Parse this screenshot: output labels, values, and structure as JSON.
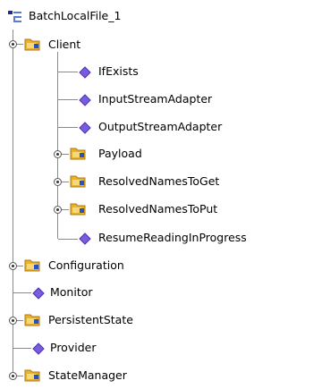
{
  "tree": {
    "root": {
      "label": "BatchLocalFile_1",
      "icon": "component-tree-icon"
    },
    "client": {
      "label": "Client",
      "icon": "folder-icon",
      "children": [
        {
          "label": "IfExists",
          "icon": "attribute-diamond-icon"
        },
        {
          "label": "InputStreamAdapter",
          "icon": "attribute-diamond-icon"
        },
        {
          "label": "OutputStreamAdapter",
          "icon": "attribute-diamond-icon"
        },
        {
          "label": "Payload",
          "icon": "folder-icon"
        },
        {
          "label": "ResolvedNamesToGet",
          "icon": "folder-icon"
        },
        {
          "label": "ResolvedNamesToPut",
          "icon": "folder-icon"
        },
        {
          "label": "ResumeReadingInProgress",
          "icon": "attribute-diamond-icon"
        }
      ]
    },
    "nodes": [
      {
        "label": "Configuration",
        "icon": "folder-icon"
      },
      {
        "label": "Monitor",
        "icon": "attribute-diamond-icon"
      },
      {
        "label": "PersistentState",
        "icon": "folder-icon"
      },
      {
        "label": "Provider",
        "icon": "attribute-diamond-icon"
      },
      {
        "label": "StateManager",
        "icon": "folder-icon"
      }
    ]
  },
  "colors": {
    "folder": "#e8b22c",
    "folder_dark": "#b07a10",
    "folder_badge": "#2a52be",
    "diamond": "#7a5ce0",
    "line": "#8a8a8a"
  }
}
